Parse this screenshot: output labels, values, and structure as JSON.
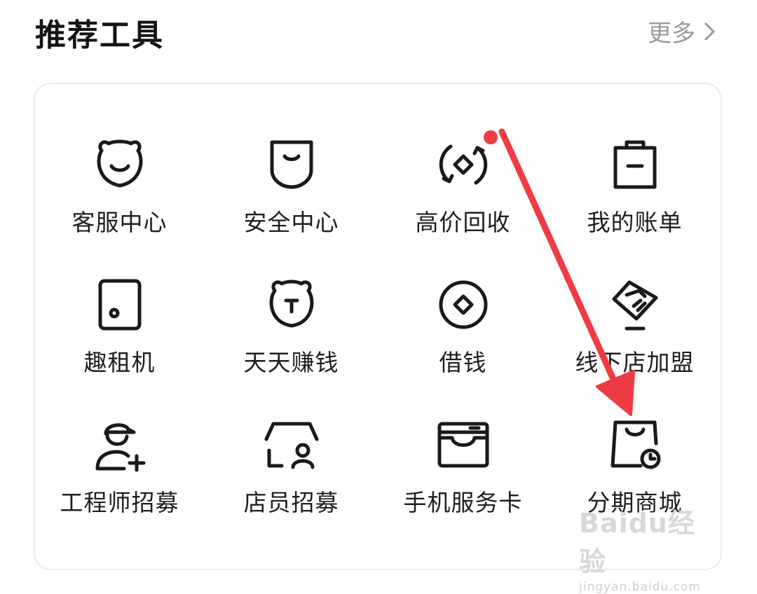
{
  "header": {
    "title": "推荐工具",
    "more_label": "更多"
  },
  "tools": [
    {
      "label": "客服中心",
      "icon": "bear-face-icon"
    },
    {
      "label": "安全中心",
      "icon": "shield-smile-icon"
    },
    {
      "label": "高价回收",
      "icon": "recycle-coin-icon"
    },
    {
      "label": "我的账单",
      "icon": "clipboard-bill-icon"
    },
    {
      "label": "趣租机",
      "icon": "phone-device-icon"
    },
    {
      "label": "天天赚钱",
      "icon": "bear-coin-icon"
    },
    {
      "label": "借钱",
      "icon": "coin-diamond-icon"
    },
    {
      "label": "线下店加盟",
      "icon": "handshake-icon"
    },
    {
      "label": "工程师招募",
      "icon": "engineer-add-icon"
    },
    {
      "label": "店员招募",
      "icon": "store-person-icon"
    },
    {
      "label": "手机服务卡",
      "icon": "service-card-icon"
    },
    {
      "label": "分期商城",
      "icon": "shopping-bag-clock-icon"
    }
  ],
  "annotation": {
    "color": "#ef3b44"
  },
  "watermark": {
    "logo": "Baidu经验",
    "url": "jingyan.baidu.com"
  }
}
